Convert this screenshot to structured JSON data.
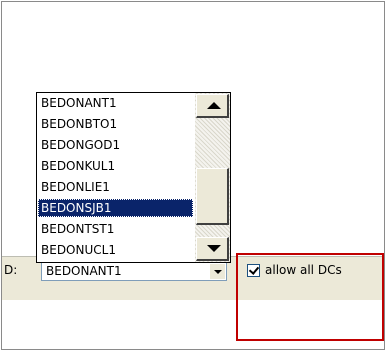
{
  "field": {
    "label": "D:",
    "value": "BEDONANT1"
  },
  "dropdown": {
    "items": [
      {
        "label": "BEDONANT1"
      },
      {
        "label": "BEDONBTO1"
      },
      {
        "label": "BEDONGOD1"
      },
      {
        "label": "BEDONKUL1"
      },
      {
        "label": "BEDONLIE1"
      },
      {
        "label": "BEDONSJB1"
      },
      {
        "label": "BEDONTST1"
      },
      {
        "label": "BEDONUCL1"
      }
    ],
    "selected_index": 5
  },
  "checkbox": {
    "label": "allow all DCs",
    "checked": true
  },
  "colors": {
    "selection": "#0a246a",
    "highlight_box": "#c00000",
    "panel": "#ece9d8"
  },
  "icons": {
    "scroll_up": "triangle-up-icon",
    "scroll_down": "triangle-down-icon",
    "combo_arrow": "chevron-down-icon",
    "check": "checkmark-icon"
  }
}
